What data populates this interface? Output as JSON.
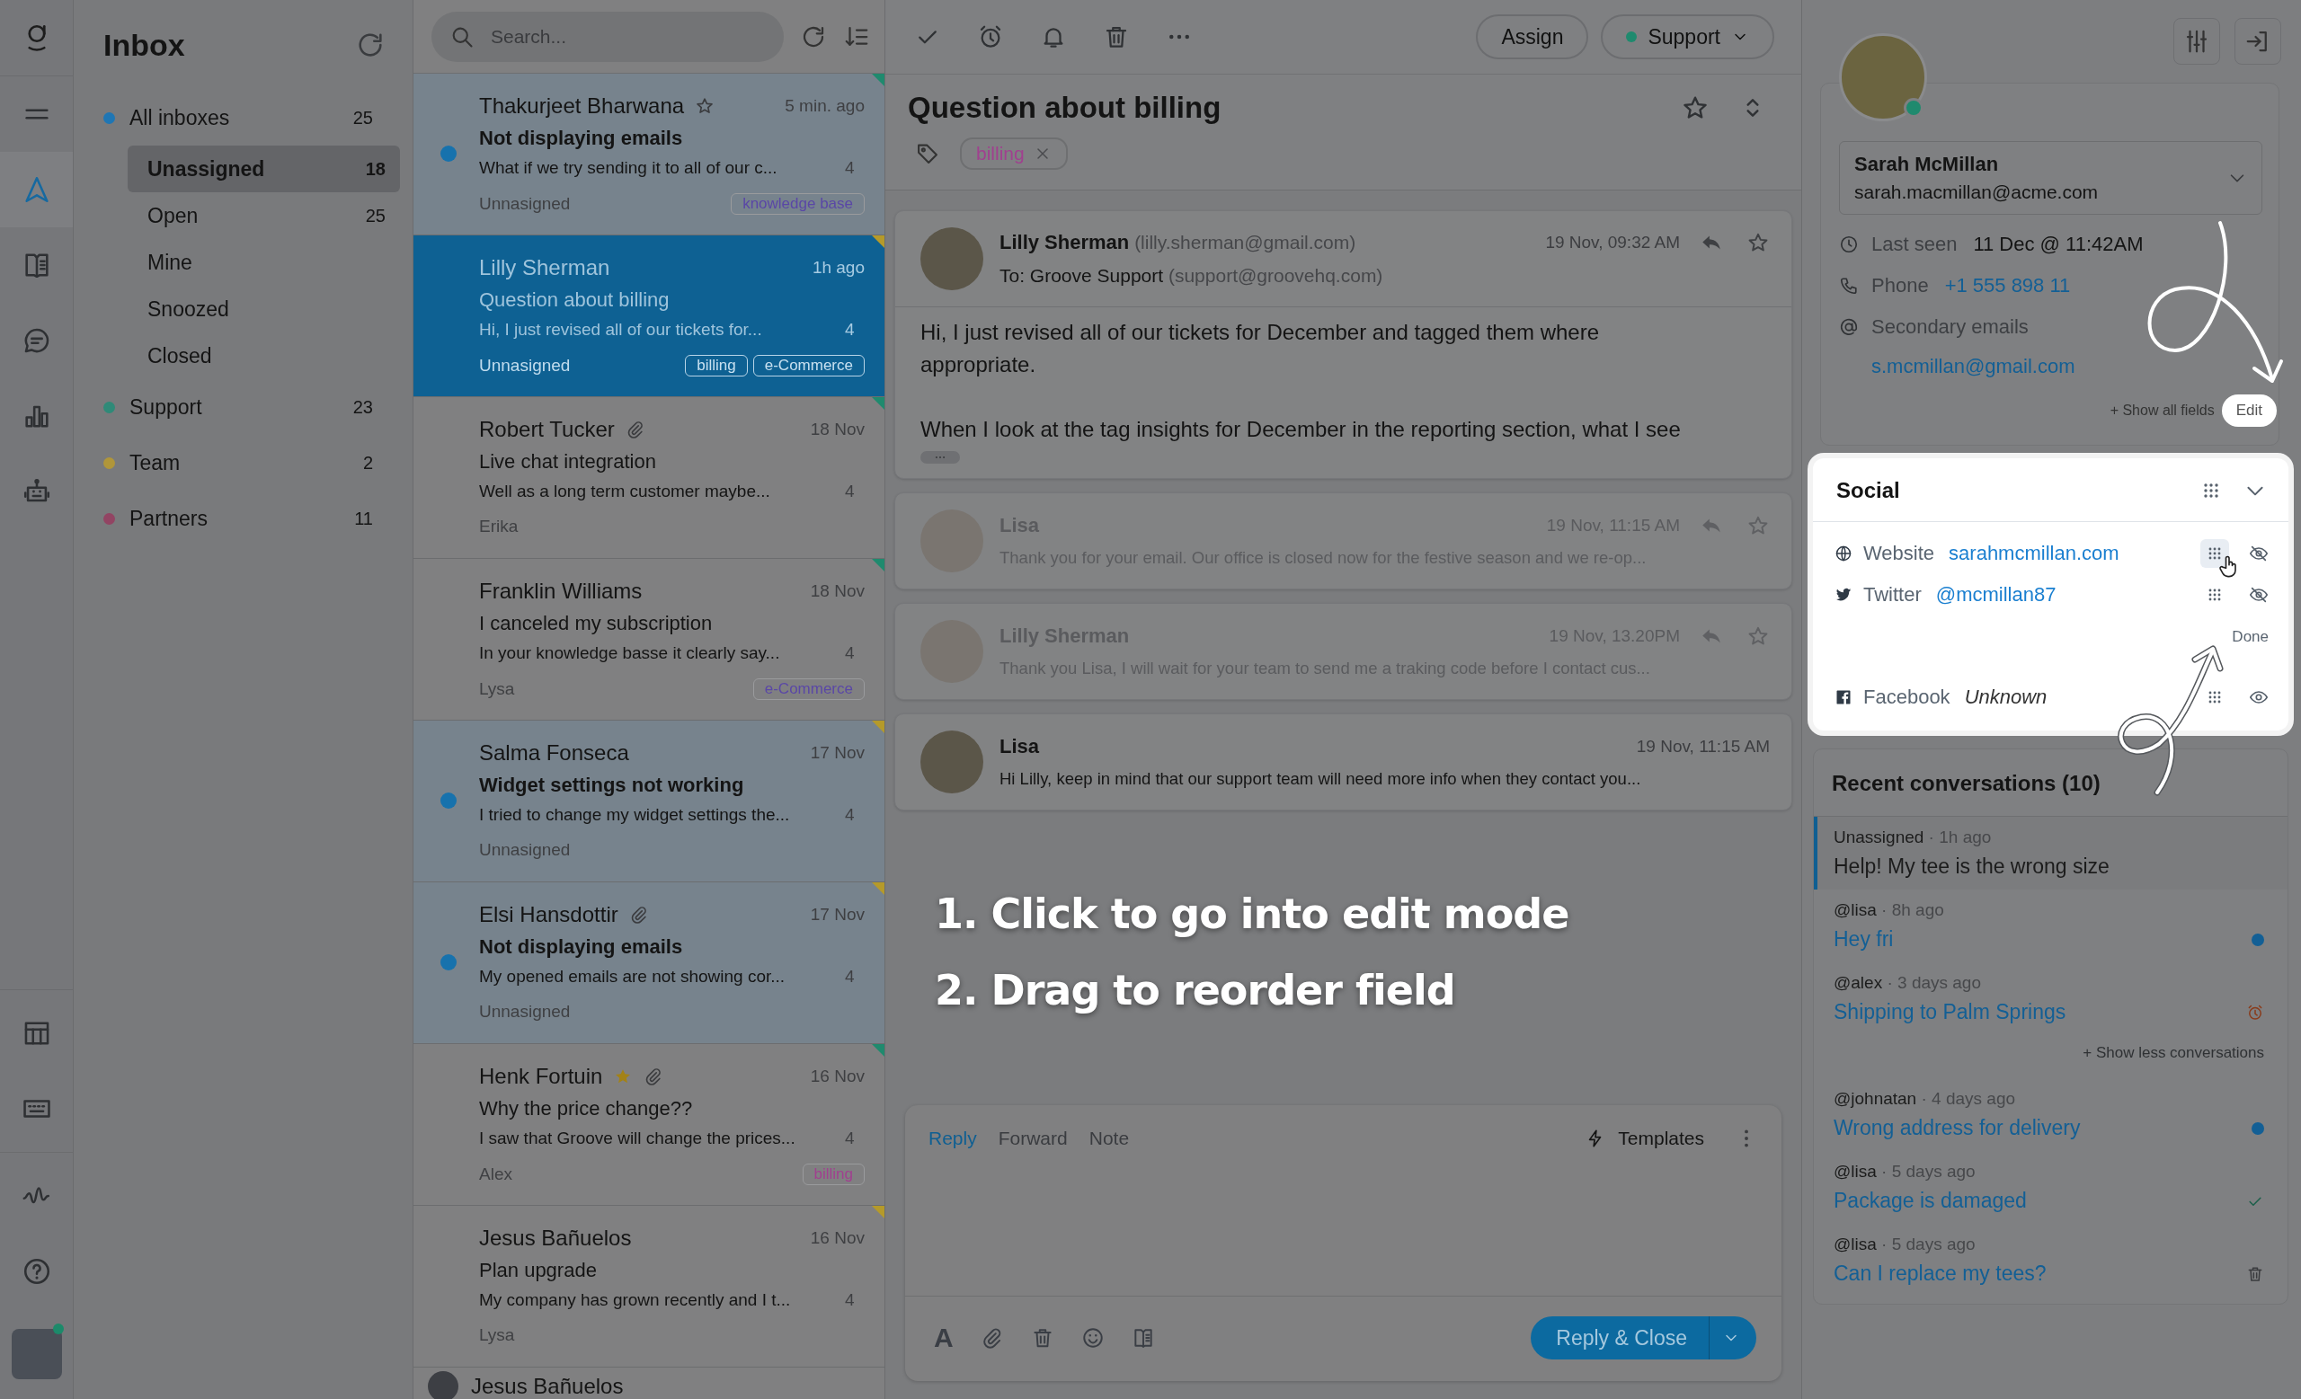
{
  "rail": {
    "top": [
      {
        "kind": "menu",
        "selected": false
      },
      {
        "kind": "send",
        "selected": true
      },
      {
        "kind": "book",
        "selected": false
      },
      {
        "kind": "chat",
        "selected": false
      },
      {
        "kind": "chart",
        "selected": false
      },
      {
        "kind": "robot",
        "selected": false
      }
    ],
    "bottom": [
      {
        "kind": "table",
        "selected": false
      },
      {
        "kind": "keyboard",
        "selected": false
      },
      {
        "kind": "activity",
        "selected": false
      },
      {
        "kind": "help",
        "selected": false
      }
    ],
    "user": {
      "online": true
    }
  },
  "cut_row": {
    "name": "Jesus Bañuelos"
  },
  "inbox": {
    "title": "Inbox",
    "folders": [
      {
        "label": "All inboxes",
        "count": "25",
        "color": "#1f76b4",
        "selected": false,
        "children": [
          {
            "label": "Unassigned",
            "count": "18",
            "selected": true
          },
          {
            "label": "Open",
            "count": "25",
            "selected": false
          },
          {
            "label": "Mine",
            "selected": false
          },
          {
            "label": "Snoozed",
            "selected": false
          },
          {
            "label": "Closed",
            "selected": false
          }
        ]
      },
      {
        "label": "Support",
        "count": "23",
        "color": "#2f8a78",
        "selected": false
      },
      {
        "label": "Team",
        "count": "2",
        "color": "#b0963a",
        "selected": false
      },
      {
        "label": "Partners",
        "count": "11",
        "color": "#924463",
        "selected": false
      }
    ]
  },
  "conversations": {
    "search": {
      "placeholder": "Search..."
    },
    "rows": [
      {
        "name": "Thakurjeet Bharwana",
        "starred": false,
        "star": true,
        "attachment": false,
        "time": "5 min. ago",
        "subject": "Not displaying emails",
        "preview": "What if we try sending it to all of our c...",
        "count": "4",
        "assignee": "Unnasigned",
        "tags": [
          {
            "label": "knowledge base",
            "color": "#5a47a6"
          }
        ],
        "unread": true,
        "selected": false,
        "color": "#1f8a6e"
      },
      {
        "name": "Lilly Sherman",
        "starred": false,
        "star": false,
        "attachment": false,
        "time": "1h ago",
        "subject": "Question about billing",
        "preview": "Hi, I just revised all of our tickets for...",
        "count": "4",
        "assignee": "Unnasigned",
        "tags": [
          {
            "label": "billing"
          },
          {
            "label": "e-Commerce"
          }
        ],
        "unread": false,
        "selected": true,
        "color": "#b59a2a"
      },
      {
        "name": "Robert Tucker",
        "starred": false,
        "star": false,
        "attachment": true,
        "time": "18 Nov",
        "subject": "Live chat integration",
        "preview": "Well as a long term customer maybe...",
        "count": "4",
        "assignee": "Erika",
        "tags": [],
        "unread": false,
        "selected": false,
        "color": "#1f8a6e"
      },
      {
        "name": "Franklin Williams",
        "starred": false,
        "star": false,
        "attachment": false,
        "time": "18 Nov",
        "subject": "I canceled my subscription",
        "preview": "In your knowledge basse it clearly say...",
        "count": "4",
        "assignee": "Lysa",
        "tags": [
          {
            "label": "e-Commerce",
            "color": "#5a47a6"
          }
        ],
        "unread": false,
        "selected": false,
        "color": "#1f8a6e"
      },
      {
        "name": "Salma Fonseca",
        "starred": false,
        "star": false,
        "attachment": false,
        "time": "17 Nov",
        "subject": "Widget settings not working",
        "preview": "I tried to change my widget settings the...",
        "count": "4",
        "assignee": "Unnasigned",
        "tags": [],
        "unread": true,
        "selected": false,
        "color": "#b59a2a"
      },
      {
        "name": "Elsi Hansdottir",
        "starred": false,
        "star": false,
        "attachment": true,
        "time": "17 Nov",
        "subject": "Not displaying emails",
        "preview": "My opened emails are not showing cor...",
        "count": "4",
        "assignee": "Unnasigned",
        "tags": [],
        "unread": true,
        "selected": false,
        "color": "#b59a2a"
      },
      {
        "name": "Henk Fortuin",
        "starred": true,
        "star": true,
        "attachment": true,
        "time": "16 Nov",
        "subject": "Why the price change??",
        "preview": "I saw that Groove will change the prices...",
        "count": "4",
        "assignee": "Alex",
        "tags": [
          {
            "label": "billing",
            "color": "#a0408f"
          }
        ],
        "unread": false,
        "selected": false,
        "color": "#1f8a6e"
      },
      {
        "name": "Jesus Bañuelos",
        "starred": false,
        "star": false,
        "attachment": false,
        "time": "16 Nov",
        "subject": "Plan upgrade",
        "preview": "My company has grown recently and I t...",
        "count": "4",
        "assignee": "Lysa",
        "tags": [],
        "unread": false,
        "selected": false,
        "color": "#b59a2a"
      }
    ]
  },
  "toolbar": {
    "assign": "Assign",
    "mailbox": {
      "label": "Support",
      "color": "#1f8a6e"
    }
  },
  "ticket": {
    "title": "Question about billing",
    "starred": false,
    "tags": [
      {
        "label": "billing",
        "color": "#a0408f"
      }
    ]
  },
  "messages": [
    {
      "kind": "expanded",
      "sender": "Lilly Sherman",
      "email": "(lilly.sherman@gmail.com)",
      "to": "To: Groove Support",
      "to_email": "(support@groovehq.com)",
      "time": "19 Nov, 09:32 AM",
      "body": [
        "Hi, I just revised all of our tickets for December and tagged them where appropriate.",
        "When I look at the tag insights for December in the reporting section, what I see"
      ],
      "muted": false,
      "actions": true
    },
    {
      "kind": "collapsed",
      "sender": "Lisa",
      "time": "19 Nov, 11:15 AM",
      "preview": "Thank you for your email. Our office is closed now for the festive season and we re-op...",
      "muted": true,
      "actions": true
    },
    {
      "kind": "collapsed",
      "sender": "Lilly Sherman",
      "time": "19 Nov, 13.20PM",
      "preview": "Thank you Lisa, I will wait for your team to send me a traking code before I contact cus...",
      "muted": true,
      "actions": true
    },
    {
      "kind": "collapsed",
      "sender": "Lisa",
      "time": "19 Nov, 11:15 AM",
      "preview": "Hi Lilly, keep in mind that our support team will need more info when they contact you...",
      "muted": false,
      "actions": false
    }
  ],
  "composer": {
    "tabs": [
      {
        "label": "Reply",
        "selected": true
      },
      {
        "label": "Forward",
        "selected": false
      },
      {
        "label": "Note",
        "selected": false
      }
    ],
    "templates": "Templates",
    "format_glyph": "A",
    "send": "Reply & Close"
  },
  "contact": {
    "online": true,
    "name": "Sarah McMillan",
    "email": "sarah.macmillan@acme.com",
    "fields": [
      {
        "kind": "last_seen",
        "label": "Last seen",
        "value": "11 Dec @ 11:42AM"
      },
      {
        "kind": "phone",
        "label": "Phone",
        "value": "+1 555 898 11"
      },
      {
        "kind": "emails",
        "label": "Secondary emails",
        "value": "s.mcmillan@gmail.com"
      }
    ],
    "show_all": "+ Show all fields",
    "edit": "Edit"
  },
  "social": {
    "title": "Social",
    "rows": [
      {
        "kind": "website",
        "label": "Website",
        "value": "sarahmcmillan.com",
        "hidden": false,
        "empty": false,
        "dragging": true
      },
      {
        "kind": "twitter",
        "label": "Twitter",
        "value": "@mcmillan87",
        "hidden": false,
        "empty": false,
        "dragging": false
      },
      {
        "kind": "facebook",
        "label": "Facebook",
        "value": "Unknown",
        "hidden": true,
        "empty": true,
        "dragging": false
      }
    ],
    "done": "Done"
  },
  "recent": {
    "title": "Recent conversations (10)",
    "items": [
      {
        "who": "Unassigned",
        "when": "· 1h ago",
        "title": "Help! My tee is the wrong size",
        "kind": "plain",
        "selected": true
      },
      {
        "who": "@lisa",
        "when": "· 8h ago",
        "title": "Hey fri",
        "kind": "open",
        "selected": false
      },
      {
        "who": "@alex",
        "when": "· 3 days ago",
        "title": "Shipping to Palm Springs",
        "kind": "snoozed",
        "selected": false
      }
    ],
    "toggle": "+ Show less conversations",
    "more": [
      {
        "who": "@johnatan",
        "when": "· 4 days ago",
        "title": "Wrong address for delivery",
        "kind": "open",
        "selected": false
      },
      {
        "who": "@lisa",
        "when": "· 5 days ago",
        "title": "Package is damaged",
        "kind": "closed",
        "selected": false
      },
      {
        "who": "@lisa",
        "when": "· 5 days ago",
        "title": "Can I replace my tees?",
        "kind": "trashed",
        "selected": false
      }
    ]
  },
  "annotations": [
    {
      "text": "1. Click to go into edit mode"
    },
    {
      "text": "2. Drag to reorder field"
    }
  ]
}
